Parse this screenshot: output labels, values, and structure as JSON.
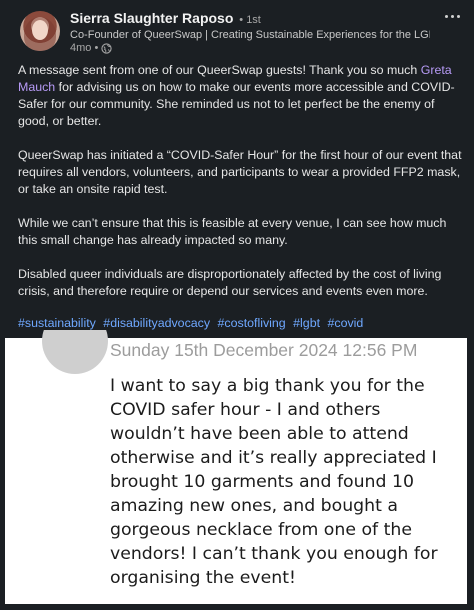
{
  "post": {
    "author": "Sierra Slaughter Raposo",
    "degree": "• 1st",
    "headline": "Co-Founder of QueerSwap | Creating Sustainable Experiences for the LGBTQ+...",
    "age": "4mo •",
    "icons": {
      "visibility": "globe-icon",
      "menu": "more-options-icon"
    },
    "paragraph1_before": "A message sent from one of our QueerSwap guests! Thank you so much ",
    "mention": "Greta Mauch",
    "paragraph1_after": " for advising us on how to make our events more accessible and COVID-Safer for our community. She reminded us not to let perfect be the enemy of good, or better.",
    "paragraph2": "QueerSwap has initiated a “COVID-Safer Hour” for the first hour of our event that requires all vendors, volunteers, and participants to wear a provided FFP2 mask, or take an onsite rapid test.",
    "paragraph3": "While we can’t ensure that this is feasible at every venue, I can see how much this small change has already impacted so many.",
    "paragraph4": "Disabled queer individuals are disproportionately affected by the cost of living crisis, and therefore require or depend our services and events even more.",
    "hashtags": [
      "#sustainability",
      "#disabilityadvocacy",
      "#costofliving",
      "#lgbt",
      "#covid"
    ],
    "colors": {
      "background": "#1b1f23",
      "mention": "#b69af5",
      "hashtag": "#6fa8ff"
    }
  },
  "message": {
    "timestamp": "Sunday 15th December 2024 12:56 PM",
    "text": "I want to say a big thank you for the COVID safer hour - I and others wouldn’t have been able to attend otherwise and it’s really appreciated I brought 10 garments and found 10 amazing new ones, and bought a gorgeous necklace from one of the vendors! I can’t thank you enough for organising the event!"
  }
}
